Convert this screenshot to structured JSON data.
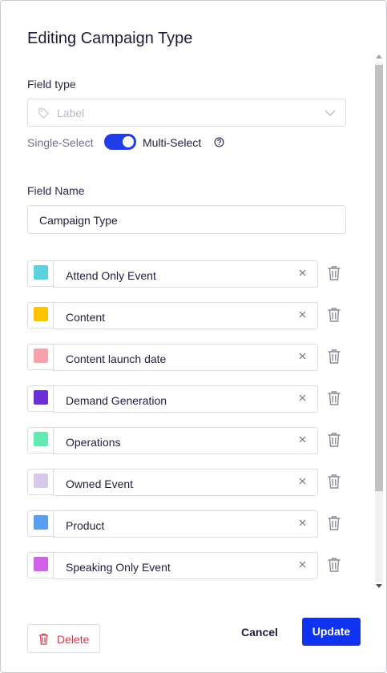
{
  "dialog": {
    "title": "Editing Campaign Type"
  },
  "field_type": {
    "label": "Field type",
    "placeholder": "Label",
    "icon": "tag-icon"
  },
  "selection_mode": {
    "single_label": "Single-Select",
    "multi_label": "Multi-Select",
    "multi_enabled": true,
    "accent": "#1f3ee8"
  },
  "field_name": {
    "label": "Field Name",
    "value": "Campaign Type"
  },
  "options": [
    {
      "label": "Attend Only Event",
      "color": "#5bd3dc"
    },
    {
      "label": "Content",
      "color": "#ffc400"
    },
    {
      "label": "Content launch date",
      "color": "#f7a1ab"
    },
    {
      "label": "Demand Generation",
      "color": "#6c2fd6"
    },
    {
      "label": "Operations",
      "color": "#63eab2"
    },
    {
      "label": "Owned Event",
      "color": "#d9c8ee"
    },
    {
      "label": "Product",
      "color": "#5b9ef0"
    },
    {
      "label": "Speaking Only Event",
      "color": "#d060ea"
    }
  ],
  "footer": {
    "delete_label": "Delete",
    "cancel_label": "Cancel",
    "update_label": "Update",
    "danger_color": "#d23a4a",
    "primary_color": "#0f33f0"
  }
}
